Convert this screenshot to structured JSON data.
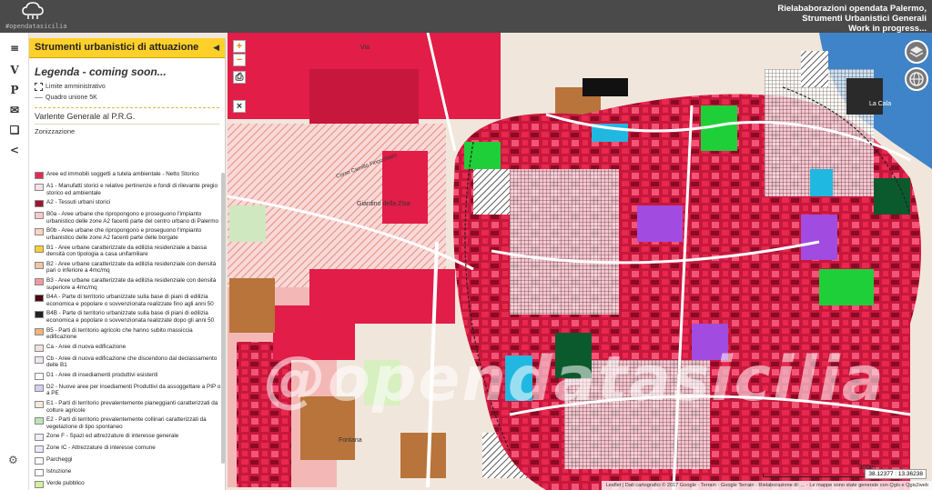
{
  "header": {
    "logo_text": "#opendatasicilia",
    "info_lines": [
      "Rielababorazioni opendata Palermo,",
      "Strumenti Urbanistici Generali",
      "Work in progress..."
    ]
  },
  "rail": {
    "items": [
      {
        "icon": "menu-icon",
        "label": "≡"
      },
      {
        "icon": "v-icon",
        "label": "V"
      },
      {
        "icon": "p-icon",
        "label": "P"
      },
      {
        "icon": "mail-icon",
        "label": "✉"
      },
      {
        "icon": "book-icon",
        "label": "❑"
      },
      {
        "icon": "share-icon",
        "label": "<"
      }
    ]
  },
  "sidebar": {
    "title": "Strumenti urbanistici di attuazione",
    "collapse": "◀",
    "legend_heading": "Legenda - coming soon...",
    "boundary_items": [
      "Limite amministrativo",
      "Quadro unione 5K"
    ],
    "variant_title": "Varlente Generale al P.R.G.",
    "zoning_title": "Zonizzazione",
    "items": [
      {
        "label": "Aree ed immobili soggetti a tutela ambientale - Netto Storico",
        "color": "#e8284e"
      },
      {
        "label": "A1 - Manufatti storici e relative pertinenze e fondi di rilevante pregio storico ed ambientale",
        "color": "#f7e0e6"
      },
      {
        "label": "A2 - Tessuti urbani storici",
        "color": "#a4122e"
      },
      {
        "label": "B0a - Aree urbane che ripropongono e proseguono l'impianto urbanistico delle zone A2 facenti parte del centro urbano di Palermo",
        "color": "#f6c9cf"
      },
      {
        "label": "B0b - Aree urbane che ripropongono e proseguono l'impianto urbanistico delle zone A2 facenti parte delle borgate",
        "color": "#f9d3c4"
      },
      {
        "label": "B1 - Aree urbane caratterizzate da edilizia residenziale a bassa densità con tipologia a casa unifamiliare",
        "color": "#f6d03a"
      },
      {
        "label": "B2 - Aree urbane caratterizzate da edilizia residenziale con densità pari o inferiore a 4mc/mq",
        "color": "#f3c4a8"
      },
      {
        "label": "B3 - Aree urbane caratterizzate da edilizia residenziale con densità superiore a 4mc/mq",
        "color": "#ef9aa2"
      },
      {
        "label": "B4A - Parte di territorio urbanizzate sulla base di piani di edilizia economica e popolare o sovvenzionata realizzate fino agli anni 50",
        "color": "#4a0610"
      },
      {
        "label": "B4B - Parte di territorio urbanizzate sulla base di piani di edilizia economica e popolare o sovvenzionata realizzate dopo gli anni 50",
        "color": "#222222"
      },
      {
        "label": "B5 - Parti di territorio agricolo che hanno subito massiccia edificazione",
        "color": "#f4b27c"
      },
      {
        "label": "Ca - Aree di nuova edificazione",
        "color": "#f2e3e0"
      },
      {
        "label": "Cb - Aree di nuova edificazione che discendono dal declassamento delle B1",
        "color": "#efe7f0"
      },
      {
        "label": "D1 - Aree di insediamenti produttivi esistenti",
        "color": "#ffffff"
      },
      {
        "label": "D2 - Nuove aree per insediamenti Produttivi da assoggettare a PIP o a PE",
        "color": "#d0d0f0"
      },
      {
        "label": "E1 - Parti di territorio prevalentemente pianeggianti caratterizzati da colture agricole",
        "color": "#f3ead6"
      },
      {
        "label": "E2 - Parti di territorio prevalentemente collinari caratterizzati da vegetazione di tipo spontaneo",
        "color": "#bfe3b4"
      },
      {
        "label": "Zone F - Spazi ed attrezzature di interesse generale",
        "color": "#eef0f7"
      },
      {
        "label": "Zone IC - Attrezzature di interesse comune",
        "color": "#e8e8f8"
      },
      {
        "label": "Parcheggi",
        "color": "#ffffff"
      },
      {
        "label": "Istruzione",
        "color": "#ffffff"
      },
      {
        "label": "Verde pubblico",
        "color": "#d6f0a0"
      },
      {
        "label": "Verde Storico",
        "color": "#ffffff"
      }
    ]
  },
  "map": {
    "zoom_in": "+",
    "zoom_out": "−",
    "print": "⎙",
    "close": "×",
    "watermark": "@opendatasicilia",
    "place_labels": [
      "Giardino della Zisa",
      "Via",
      "Corso Camillo Finocchiaro",
      "La Cala",
      "Fontana"
    ],
    "coords": "38.12377 : 13.36238",
    "scale_label": "300m",
    "attribution": "Leaflet | Dati cartografici © 2017 Google - Terrain - Google Terrain - Rielaborazione di: ... - Le mappe sono state generate con Qgis e Qgis2web"
  },
  "colors": {
    "topbar": "#4a4a4a",
    "accent": "#ffd02a",
    "crimson": "#e11d48",
    "dark_red": "#8a0b24",
    "green": "#1fcf3a",
    "purple": "#a24be0",
    "cyan": "#20b8e0"
  }
}
